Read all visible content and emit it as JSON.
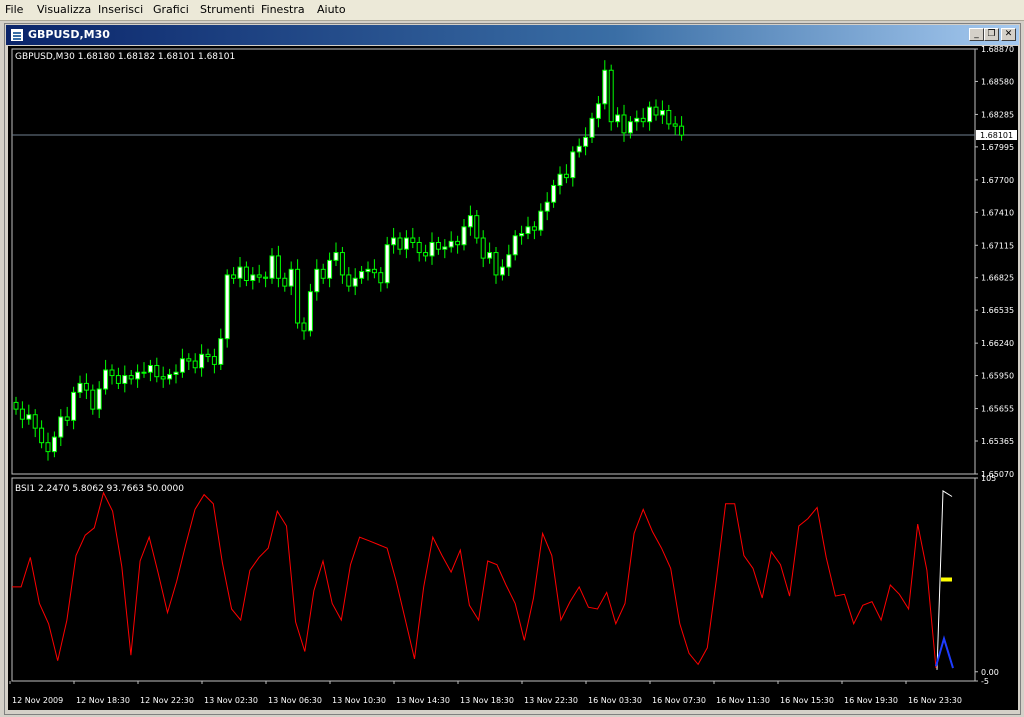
{
  "menu": [
    "File",
    "Visualizza",
    "Inserisci",
    "Grafici",
    "Strumenti",
    "Finestra",
    "Aiuto"
  ],
  "window": {
    "title": "GBPUSD,M30",
    "buttons": {
      "minimize": "_",
      "restore": "❐",
      "close": "✕"
    }
  },
  "price_panel": {
    "label": "GBPUSD,M30  1.68180 1.68182 1.68101 1.68101",
    "axis_ticks": [
      "1.68870",
      "1.68580",
      "1.68285",
      "1.67995",
      "1.67700",
      "1.67410",
      "1.67115",
      "1.66825",
      "1.66535",
      "1.66240",
      "1.65950",
      "1.65655",
      "1.65365",
      "1.65070"
    ],
    "last_price": "1.68101",
    "colors": {
      "bull": "#ffffff",
      "bear": "#000000",
      "wick": "#00ff00",
      "price_line": "#708090"
    }
  },
  "indicator_panel": {
    "label": "BSI1 2.2470 5.8062 93.7663 50.0000",
    "axis_top": "105",
    "axis_bottom": "0.00",
    "axis_minus": "-5",
    "colors": {
      "main": "#ff0000",
      "white": "#ffffff",
      "blue": "#1e3cff",
      "marker": "#ffff00"
    }
  },
  "time_axis": [
    "12 Nov 2009",
    "12 Nov 18:30",
    "12 Nov 22:30",
    "13 Nov 02:30",
    "13 Nov 06:30",
    "13 Nov 10:30",
    "13 Nov 14:30",
    "13 Nov 18:30",
    "13 Nov 22:30",
    "16 Nov 03:30",
    "16 Nov 07:30",
    "16 Nov 11:30",
    "16 Nov 15:30",
    "16 Nov 19:30",
    "16 Nov 23:30"
  ],
  "chart_data": [
    {
      "type": "candlestick",
      "series": [
        {
          "name": "GBPUSD,M30",
          "close": [
            1.6565,
            1.6556,
            1.656,
            1.6548,
            1.6535,
            1.6527,
            1.654,
            1.6558,
            1.6555,
            1.658,
            1.6588,
            1.6582,
            1.6565,
            1.6583,
            1.66,
            1.6595,
            1.6588,
            1.6595,
            1.6592,
            1.6598,
            1.6598,
            1.6604,
            1.6594,
            1.6592,
            1.6596,
            1.6598,
            1.661,
            1.6608,
            1.6602,
            1.6614,
            1.6612,
            1.6605,
            1.6628,
            1.6685,
            1.6682,
            1.6692,
            1.668,
            1.6685,
            1.6683,
            1.6682,
            1.6702,
            1.6682,
            1.6675,
            1.669,
            1.6642,
            1.6635,
            1.667,
            1.669,
            1.6682,
            1.6698,
            1.6705,
            1.6685,
            1.6675,
            1.6682,
            1.6688,
            1.669,
            1.6687,
            1.6678,
            1.6712,
            1.6718,
            1.6708,
            1.6718,
            1.6714,
            1.6705,
            1.6702,
            1.6714,
            1.6708,
            1.671,
            1.6715,
            1.6712,
            1.6728,
            1.6738,
            1.6718,
            1.67,
            1.6705,
            1.6685,
            1.6692,
            1.6703,
            1.672,
            1.6722,
            1.6728,
            1.6725,
            1.6742,
            1.675,
            1.6765,
            1.6775,
            1.6772,
            1.6795,
            1.68,
            1.6808,
            1.6825,
            1.6838,
            1.6868,
            1.6822,
            1.6828,
            1.6812,
            1.6822,
            1.6825,
            1.6822,
            1.6835,
            1.6828,
            1.6832,
            1.682,
            1.6818,
            1.681
          ]
        }
      ],
      "ylim": [
        1.6507,
        1.6887
      ]
    },
    {
      "type": "line",
      "series": [
        {
          "values": [
            46,
            46,
            62,
            37,
            26,
            6,
            28,
            63,
            74,
            78,
            97,
            87,
            57,
            9,
            60,
            73,
            53,
            32,
            49,
            69,
            88,
            96,
            91,
            59,
            34,
            28,
            55,
            62,
            67,
            87,
            79,
            27,
            11,
            44,
            60,
            37,
            28,
            58,
            73,
            71,
            69,
            67,
            49,
            28,
            7,
            46,
            73,
            63,
            54,
            66,
            36,
            28,
            60,
            58,
            47,
            37,
            17,
            40,
            75,
            63,
            28,
            38,
            46,
            35,
            34,
            43,
            26,
            37,
            75,
            88,
            76,
            67,
            56,
            26,
            10,
            4,
            13,
            50,
            91,
            91,
            63,
            56,
            40,
            65,
            58,
            41,
            79,
            83,
            89,
            62,
            41,
            42,
            26,
            36,
            38,
            28,
            47,
            42,
            34,
            80,
            55,
            2
          ]
        },
        {
          "values": [
            1,
            98,
            95
          ]
        },
        {
          "values": [
            3,
            18,
            2
          ]
        }
      ],
      "marker_level": 50,
      "ylim": [
        -5,
        105
      ]
    }
  ]
}
